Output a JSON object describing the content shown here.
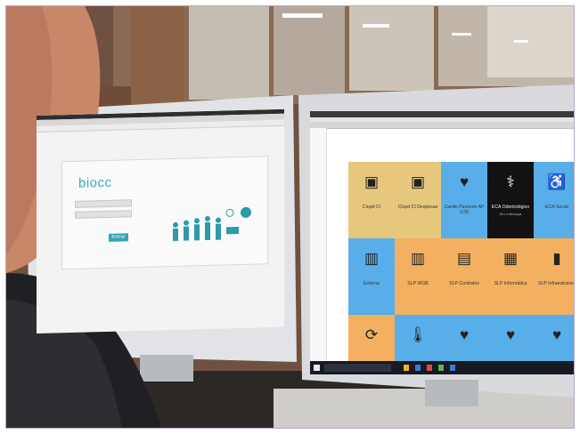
{
  "scene": {
    "description_colors": {
      "wall": "#7b5b44",
      "ceiling": "#c9c3b8",
      "monitor_frame": "#d9dbde",
      "person_skin": "#c7896b",
      "jacket": "#1f2024"
    }
  },
  "left_monitor": {
    "logo": "biocc",
    "login_button": "Entrar",
    "username_placeholder": "",
    "password_placeholder": ""
  },
  "right_monitor": {
    "tiles": [
      {
        "label": "Clopd CI",
        "sub": "",
        "color": "#e7c77c",
        "icon": "id-card-icon",
        "glyph": "▣"
      },
      {
        "label": "Clopd CI Despesas",
        "sub": "",
        "color": "#e7c77c",
        "icon": "id-card-icon",
        "glyph": "▣"
      },
      {
        "label": "Cardio Paciente AP 2.00",
        "sub": "",
        "color": "#58aee9",
        "icon": "heart-pulse-icon",
        "glyph": "♥"
      },
      {
        "label": "ECA Odontológico",
        "sub": "Em Cobrança",
        "color": "#121212",
        "icon": "doctor-icon",
        "glyph": "⚕"
      },
      {
        "label": "ECA Social",
        "sub": "",
        "color": "#58aee9",
        "icon": "accessibility-icon",
        "glyph": "♿"
      },
      {
        "label": "Externa",
        "sub": "",
        "color": "#58aee9",
        "icon": "bar-chart-icon",
        "glyph": "▥"
      },
      {
        "label": "SLP WGB",
        "sub": "",
        "color": "#f2b060",
        "icon": "bar-chart-icon",
        "glyph": "▥"
      },
      {
        "label": "SLP Contratos",
        "sub": "",
        "color": "#f2b060",
        "icon": "clipboard-icon",
        "glyph": "▤"
      },
      {
        "label": "SLP Informática",
        "sub": "",
        "color": "#f2b060",
        "icon": "chip-icon",
        "glyph": "▦"
      },
      {
        "label": "SLP Infraestrutura",
        "sub": "",
        "color": "#f2b060",
        "icon": "building-icon",
        "glyph": "▮"
      },
      {
        "label": "",
        "sub": "",
        "color": "#f2b060",
        "icon": "refresh-icon",
        "glyph": "⟳"
      },
      {
        "label": "",
        "sub": "",
        "color": "#58aee9",
        "icon": "thermometer-icon",
        "glyph": "🌡"
      },
      {
        "label": "",
        "sub": "",
        "color": "#58aee9",
        "icon": "heart-pulse-icon",
        "glyph": "♥"
      },
      {
        "label": "",
        "sub": "",
        "color": "#58aee9",
        "icon": "heart-pulse-icon",
        "glyph": "♥"
      },
      {
        "label": "",
        "sub": "",
        "color": "#58aee9",
        "icon": "heart-pulse-icon",
        "glyph": "♥"
      }
    ]
  }
}
